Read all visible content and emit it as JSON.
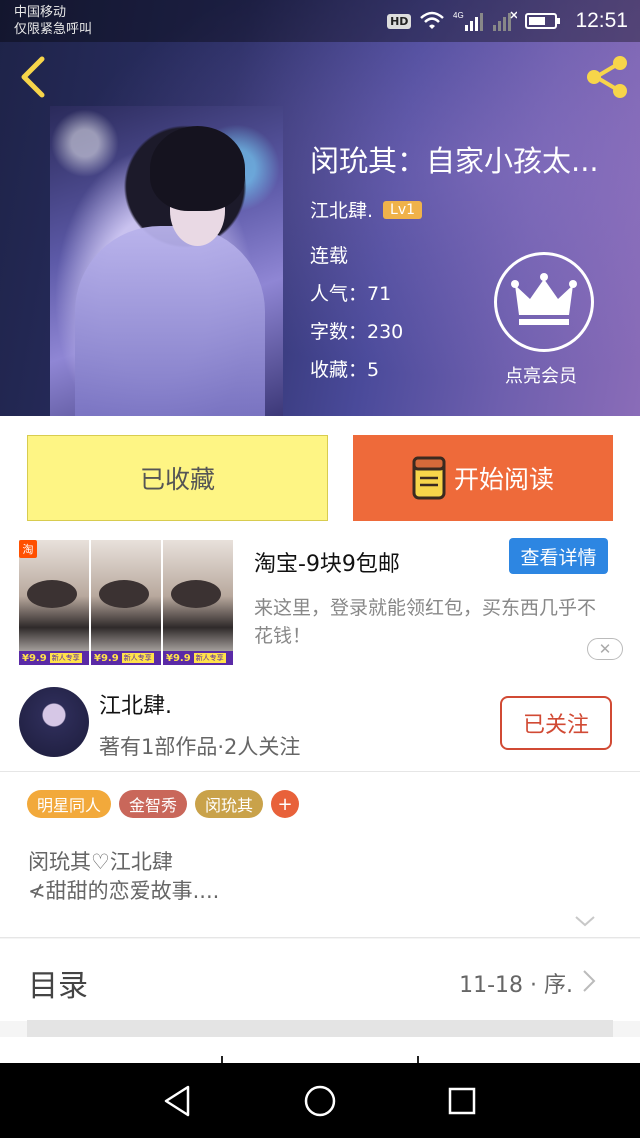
{
  "status_bar": {
    "carrier": "中国移动",
    "emergency": "仅限紧急呼叫",
    "hd": "HD",
    "network": "4G",
    "time": "12:51"
  },
  "book": {
    "title": "闵玧其：自家小孩太...",
    "author": "江北肆.",
    "level": "Lv1",
    "status": "连载",
    "popularity": "人气：71",
    "word_count": "字数：230",
    "favorites": "收藏：5",
    "vip_label": "点亮会员"
  },
  "actions": {
    "favorited_label": "已收藏",
    "read_label": "开始阅读"
  },
  "ad": {
    "title": "淘宝-9块9包邮",
    "detail_button": "查看详情",
    "description": "来这里，登录就能领红包，买东西几乎不花钱！",
    "badge": "淘",
    "price": "¥9.9",
    "price_tag": "新人专享",
    "close": "✕"
  },
  "author_info": {
    "name": "江北肆.",
    "stats": "著有1部作品·2人关注",
    "follow_label": "已关注"
  },
  "tags": [
    {
      "label": "明星同人",
      "color": "#f2a93b"
    },
    {
      "label": "金智秀",
      "color": "#c9675a"
    },
    {
      "label": "闵玧其",
      "color": "#c9a24a"
    }
  ],
  "tag_add": "+",
  "intro": {
    "line1": "闵玧其♡江北肆",
    "line2": "≮甜甜的恋爱故事...."
  },
  "catalog": {
    "title": "目录",
    "latest": "11-18 · 序."
  },
  "colors": {
    "accent_orange": "#ee6a3a",
    "favorite_yellow": "#fef584",
    "ad_blue": "#2d86e2",
    "follow_red": "#d14a34",
    "level_badge": "#f0b24a",
    "icon_yellow": "#f7d54a"
  }
}
